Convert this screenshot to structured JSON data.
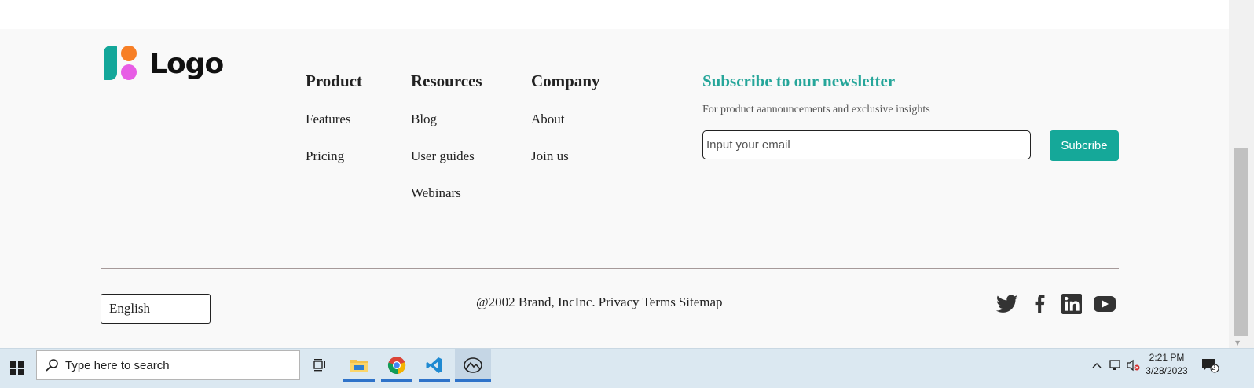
{
  "brand": {
    "logo_text": "Logo",
    "colors": {
      "teal": "#14a79a",
      "orange": "#f77f26",
      "pink": "#e75de5"
    }
  },
  "columns": [
    {
      "title": "Product",
      "links": [
        "Features",
        "Pricing"
      ]
    },
    {
      "title": "Resources",
      "links": [
        "Blog",
        "User guides",
        "Webinars"
      ]
    },
    {
      "title": "Company",
      "links": [
        "About",
        "Join us"
      ]
    }
  ],
  "newsletter": {
    "title": "Subscribe to our newsletter",
    "subtitle": "For product aannouncements and exclusive insights",
    "placeholder": "Input your email",
    "button": "Subcribe",
    "accent": "#15a899"
  },
  "bottom": {
    "language": "English",
    "copyright": "@2002 Brand, IncInc.",
    "links": [
      "Privacy",
      "Terms",
      "Sitemap"
    ]
  },
  "social": [
    "twitter-icon",
    "facebook-icon",
    "linkedin-icon",
    "youtube-icon"
  ],
  "taskbar": {
    "search_placeholder": "Type here to search",
    "apps": [
      "task-view-icon",
      "file-explorer-icon",
      "chrome-icon",
      "vscode-icon",
      "photos-icon"
    ],
    "time": "2:21 PM",
    "date": "3/28/2023",
    "notification_count": "2"
  }
}
